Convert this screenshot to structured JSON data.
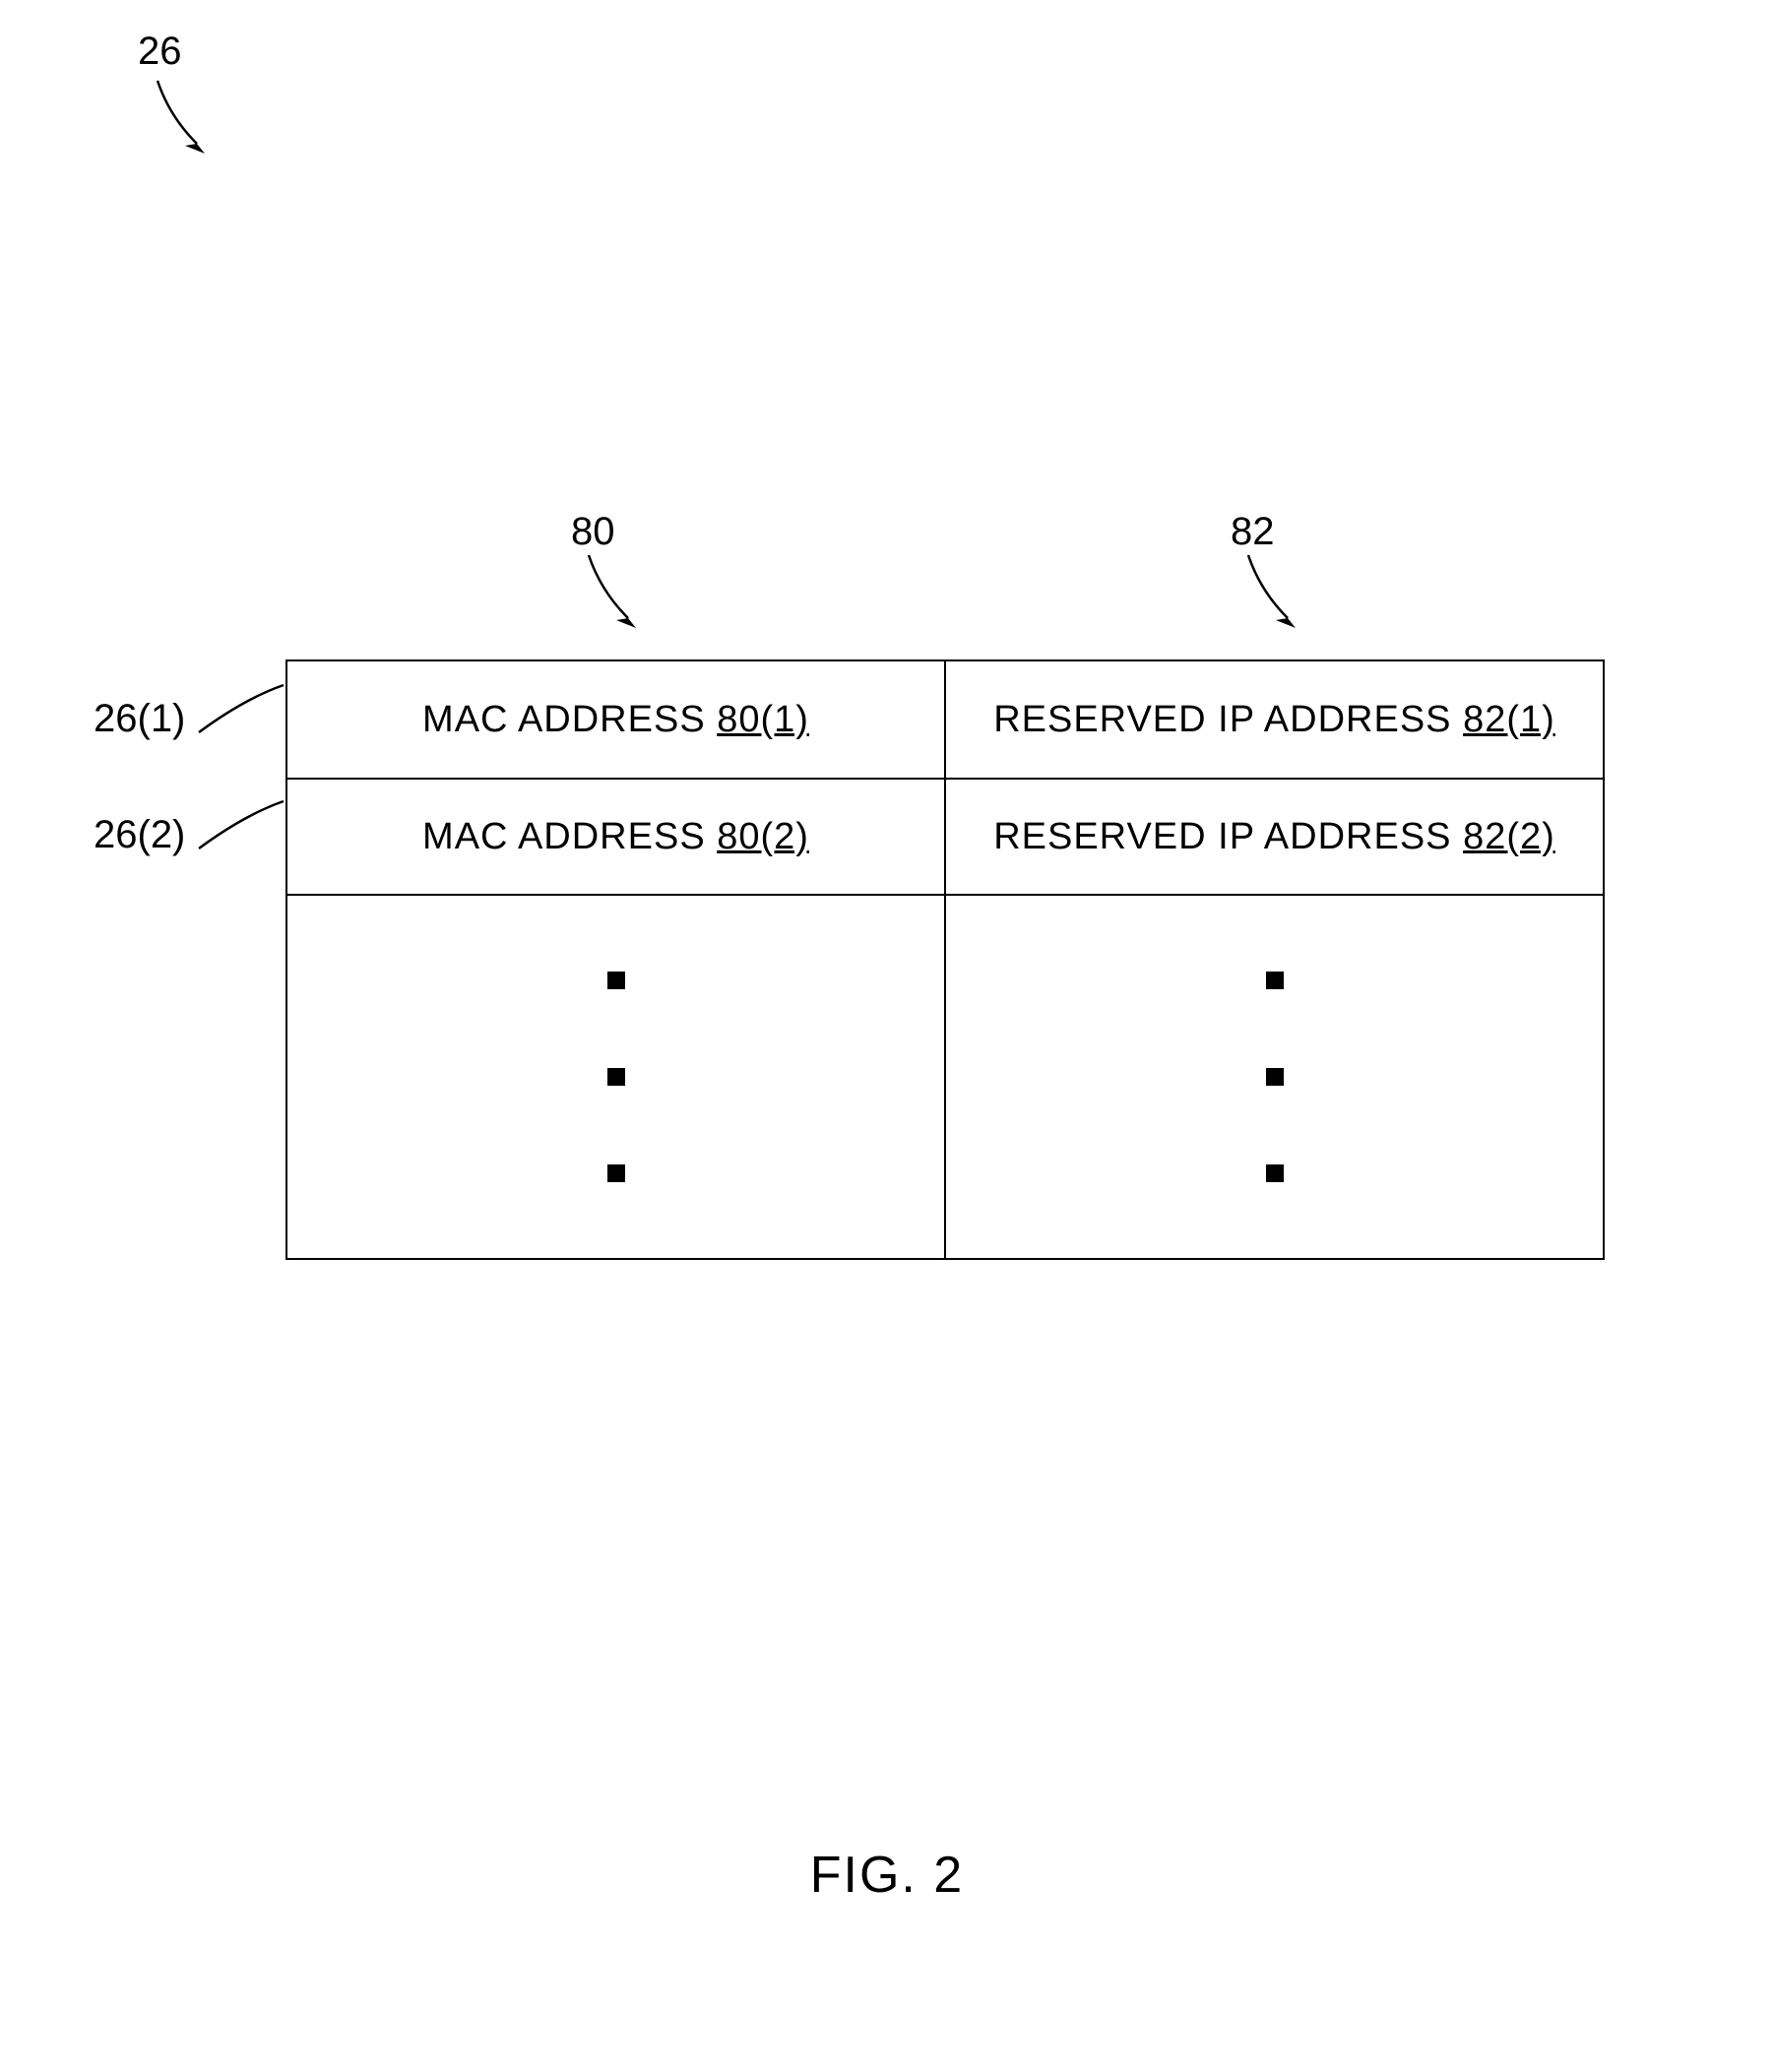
{
  "refs": {
    "figure_ref": "26",
    "col1_ref": "80",
    "col2_ref": "82",
    "row1_ref": "26(1)",
    "row2_ref": "26(2)"
  },
  "table": {
    "row1": {
      "col1_prefix": "MAC ADDRESS ",
      "col1_ref": "80(1)",
      "col2_prefix": "RESERVED IP ADDRESS ",
      "col2_ref": "82(1)"
    },
    "row2": {
      "col1_prefix": "MAC ADDRESS ",
      "col1_ref": "80(2)",
      "col2_prefix": "RESERVED IP ADDRESS ",
      "col2_ref": "82(2)"
    }
  },
  "caption": "FIG. 2"
}
